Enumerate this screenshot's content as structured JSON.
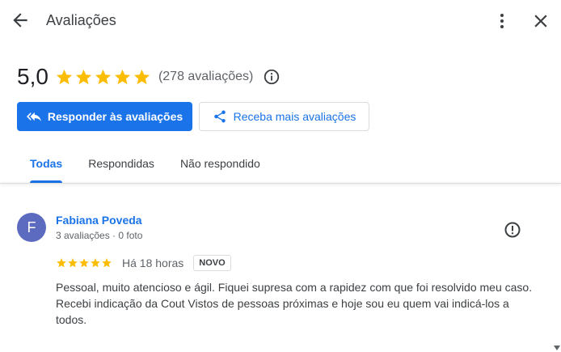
{
  "header": {
    "title": "Avaliações",
    "back_icon": "arrow-back-icon",
    "more_icon": "more-vertical-icon",
    "close_icon": "close-icon"
  },
  "summary": {
    "rating": "5,0",
    "stars": 5,
    "review_count": "(278 avaliações)",
    "info_icon": "info-icon",
    "star_color": "#fbbc04"
  },
  "actions": {
    "reply_label": "Responder às avaliações",
    "get_more_label": "Receba mais avaliações",
    "primary_color": "#1a73e8"
  },
  "tabs": [
    {
      "label": "Todas",
      "active": true
    },
    {
      "label": "Respondidas",
      "active": false
    },
    {
      "label": "Não respondido",
      "active": false
    }
  ],
  "review": {
    "avatar_letter": "F",
    "avatar_color": "#5c6bc0",
    "name": "Fabiana Poveda",
    "meta": "3 avaliações · 0 foto",
    "stars": 5,
    "date": "Há 18 horas",
    "badge": "NOVO",
    "text": "Pessoal, muito atencioso e ágil. Fiquei supresa com a rapidez com que foi resolvido meu caso. Recebi indicação da Cout Vistos de pessoas próximas e hoje sou eu quem vai indicá-los a todos."
  }
}
